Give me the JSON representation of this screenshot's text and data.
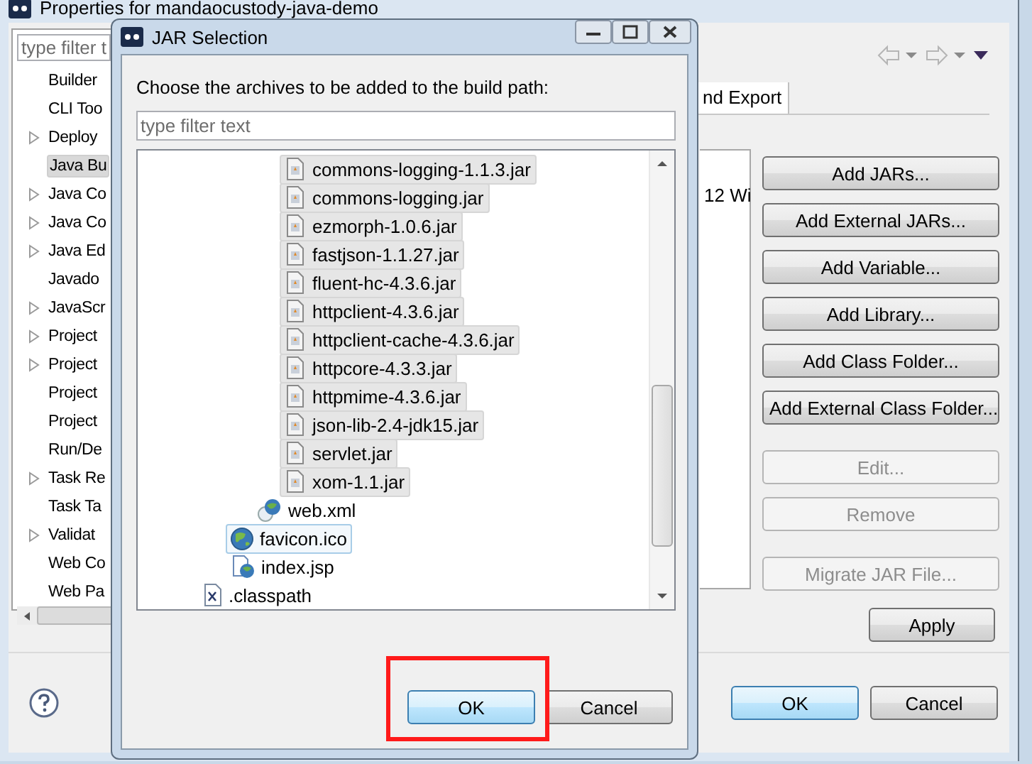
{
  "window": {
    "title": "Properties for mandaocustody-java-demo",
    "filter_placeholder": "type filter t",
    "sidebar": {
      "items": [
        {
          "label": "Builder",
          "expandable": false,
          "selected": false
        },
        {
          "label": "CLI Too",
          "expandable": false,
          "selected": false
        },
        {
          "label": "Deploy",
          "expandable": true,
          "selected": false
        },
        {
          "label": "Java Bu",
          "expandable": false,
          "selected": true
        },
        {
          "label": "Java Co",
          "expandable": true,
          "selected": false
        },
        {
          "label": "Java Co",
          "expandable": true,
          "selected": false
        },
        {
          "label": "Java Ed",
          "expandable": true,
          "selected": false
        },
        {
          "label": "Javado",
          "expandable": false,
          "selected": false
        },
        {
          "label": "JavaScr",
          "expandable": true,
          "selected": false
        },
        {
          "label": "Project",
          "expandable": true,
          "selected": false
        },
        {
          "label": "Project",
          "expandable": true,
          "selected": false
        },
        {
          "label": "Project",
          "expandable": false,
          "selected": false
        },
        {
          "label": "Project",
          "expandable": false,
          "selected": false
        },
        {
          "label": "Run/De",
          "expandable": false,
          "selected": false
        },
        {
          "label": "Task Re",
          "expandable": true,
          "selected": false
        },
        {
          "label": "Task Ta",
          "expandable": false,
          "selected": false
        },
        {
          "label": "Validat",
          "expandable": true,
          "selected": false
        },
        {
          "label": "Web Co",
          "expandable": false,
          "selected": false
        },
        {
          "label": "Web Pa",
          "expandable": false,
          "selected": false
        }
      ]
    },
    "tab": {
      "label": "nd Export",
      "selected": true
    },
    "list": {
      "items": [
        "12 Wi"
      ]
    },
    "side_buttons": [
      {
        "label": "Add JARs...",
        "disabled": false
      },
      {
        "label": "Add External JARs...",
        "disabled": false
      },
      {
        "label": "Add Variable...",
        "disabled": false
      },
      {
        "label": "Add Library...",
        "disabled": false
      },
      {
        "label": "Add Class Folder...",
        "disabled": false
      },
      {
        "label": "Add External Class Folder...",
        "disabled": false
      },
      {
        "label": "Edit...",
        "disabled": true
      },
      {
        "label": "Remove",
        "disabled": true
      },
      {
        "label": "Migrate JAR File...",
        "disabled": true
      }
    ],
    "apply": "Apply",
    "buttons": [
      {
        "label": "OK",
        "default": true
      },
      {
        "label": "Cancel",
        "default": false
      }
    ]
  },
  "dialog": {
    "title": "JAR Selection",
    "prompt": "Choose the archives to be added to the build path:",
    "filter_placeholder": "type filter text",
    "tree": [
      {
        "children": [
          {
            "children": [
              {
                "children": [
                  {
                    "label": "commons-logging-1.1.3.jar",
                    "kind": "jar",
                    "selected": true,
                    "focused": false
                  },
                  {
                    "label": "commons-logging.jar",
                    "kind": "jar",
                    "selected": true,
                    "focused": false
                  },
                  {
                    "label": "ezmorph-1.0.6.jar",
                    "kind": "jar",
                    "selected": true,
                    "focused": false
                  },
                  {
                    "label": "fastjson-1.1.27.jar",
                    "kind": "jar",
                    "selected": true,
                    "focused": false
                  },
                  {
                    "label": "fluent-hc-4.3.6.jar",
                    "kind": "jar",
                    "selected": true,
                    "focused": false
                  },
                  {
                    "label": "httpclient-4.3.6.jar",
                    "kind": "jar",
                    "selected": true,
                    "focused": false
                  },
                  {
                    "label": "httpclient-cache-4.3.6.jar",
                    "kind": "jar",
                    "selected": true,
                    "focused": false
                  },
                  {
                    "label": "httpcore-4.3.3.jar",
                    "kind": "jar",
                    "selected": true,
                    "focused": false
                  },
                  {
                    "label": "httpmime-4.3.6.jar",
                    "kind": "jar",
                    "selected": true,
                    "focused": false
                  },
                  {
                    "label": "json-lib-2.4-jdk15.jar",
                    "kind": "jar",
                    "selected": true,
                    "focused": false
                  },
                  {
                    "label": "servlet.jar",
                    "kind": "jar",
                    "selected": true,
                    "focused": false
                  },
                  {
                    "label": "xom-1.1.jar",
                    "kind": "jar",
                    "selected": true,
                    "focused": false
                  }
                ]
              },
              {
                "label": "web.xml",
                "kind": "xml",
                "selected": false,
                "focused": false
              }
            ]
          },
          {
            "label": "favicon.ico",
            "kind": "web",
            "selected": false,
            "focused": true
          },
          {
            "label": "index.jsp",
            "kind": "jsp",
            "selected": false,
            "focused": false
          }
        ]
      },
      {
        "label": ".classpath",
        "kind": "classpath",
        "selected": false,
        "focused": false
      }
    ],
    "buttons": [
      {
        "label": "OK",
        "default": true,
        "highlighted": true
      },
      {
        "label": "Cancel",
        "default": false,
        "highlighted": false
      }
    ]
  }
}
